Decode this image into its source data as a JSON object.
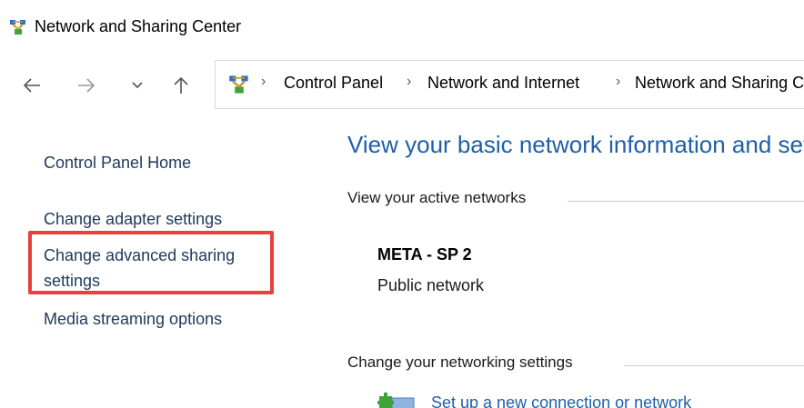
{
  "window": {
    "title": "Network and Sharing Center",
    "title_icon": "network-center-icon"
  },
  "nav": {
    "back_icon": "back-arrow-icon",
    "forward_icon": "forward-arrow-icon",
    "recent_icon": "chevron-down-icon",
    "up_icon": "up-arrow-icon",
    "address_icon": "network-center-icon",
    "breadcrumb_separator": "›",
    "breadcrumbs": [
      "Control Panel",
      "Network and Internet",
      "Network and Sharing Center"
    ]
  },
  "left_pane": {
    "links": [
      "Control Panel Home",
      "Change adapter settings",
      "Change advanced sharing",
      "settings",
      "Media streaming options"
    ],
    "highlight_color": "#e8413c"
  },
  "main": {
    "title": "View your basic network information and set up connections",
    "active_networks_heading": "View your active networks",
    "network_name": "META - SP 2",
    "network_type": "Public network",
    "change_settings_heading": "Change your networking settings",
    "setup_link": "Set up a new connection or network",
    "setup_icon": "new-connection-icon"
  },
  "colors": {
    "link": "#1e395b",
    "title_blue": "#1e5fa8"
  }
}
